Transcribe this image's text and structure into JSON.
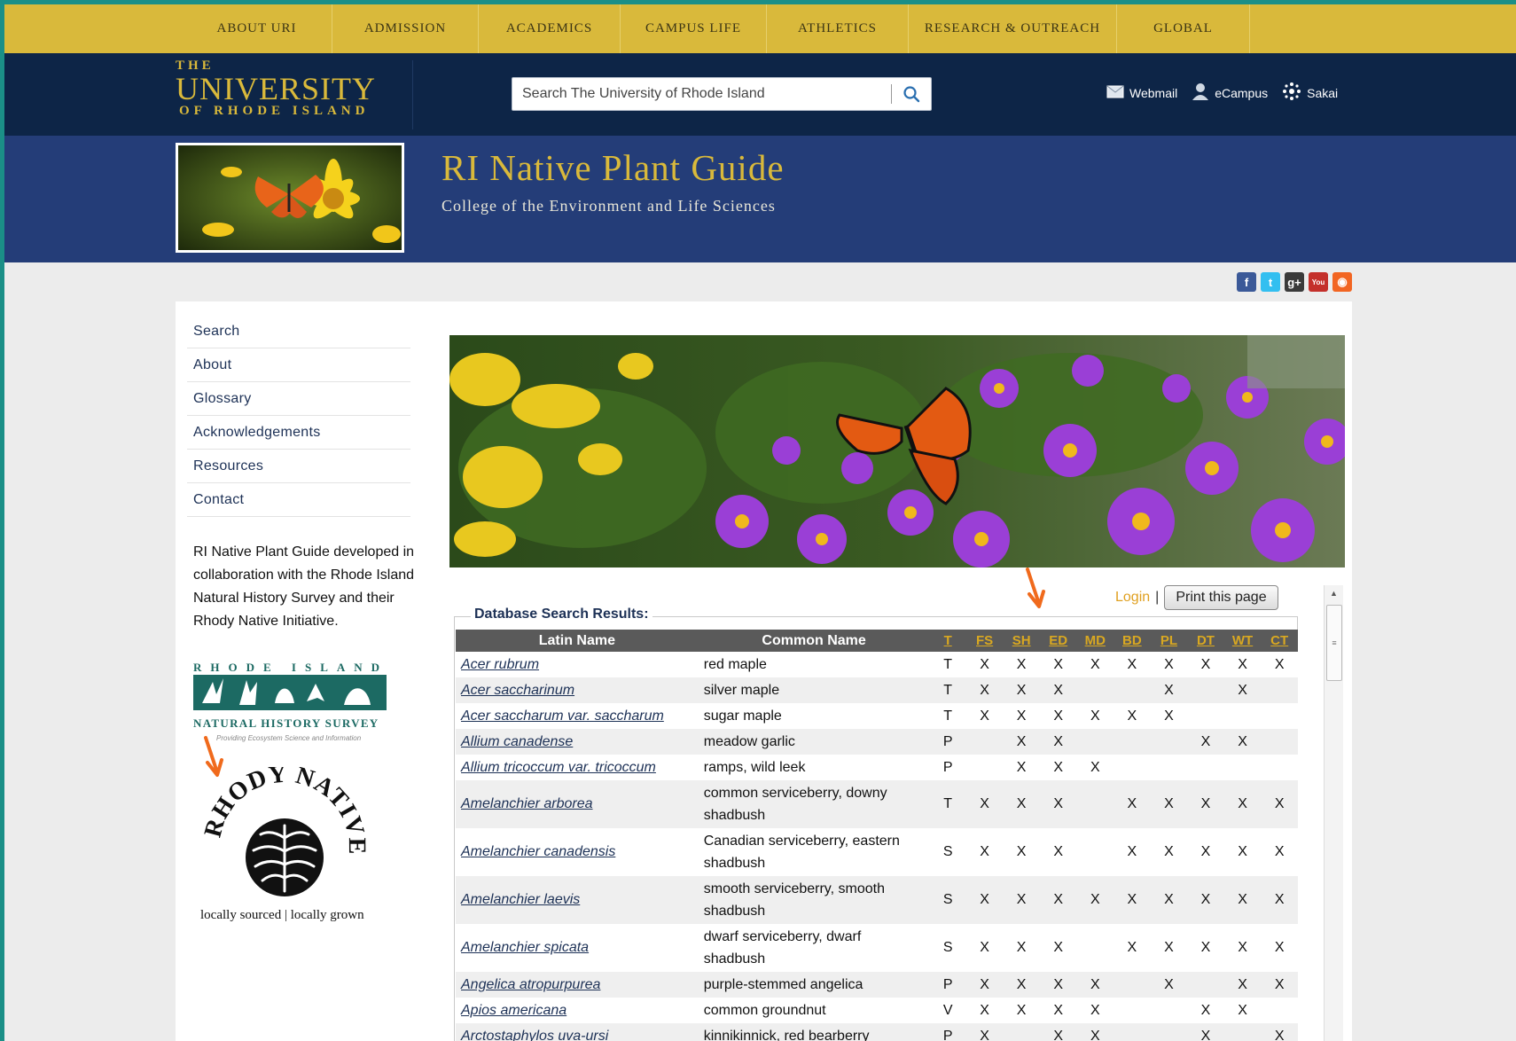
{
  "colors": {
    "frame": "#1b8f87",
    "gold": "#d9b93b",
    "navy": "#0d2547",
    "banner": "#243d78",
    "arrow": "#f06a1c"
  },
  "topnav": [
    "ABOUT URI",
    "ADMISSION",
    "ACADEMICS",
    "CAMPUS LIFE",
    "ATHLETICS",
    "RESEARCH & OUTREACH",
    "GLOBAL"
  ],
  "logo": {
    "the": "THE",
    "university": "UNIVERSITY",
    "ri": "OF RHODE ISLAND"
  },
  "search": {
    "placeholder": "Search The University of Rhode Island",
    "icon": "search-icon"
  },
  "quicklinks": [
    {
      "label": "Webmail",
      "icon": "mail-icon"
    },
    {
      "label": "eCampus",
      "icon": "person-icon"
    },
    {
      "label": "Sakai",
      "icon": "sakai-dots-icon"
    }
  ],
  "site": {
    "title": "RI Native Plant Guide",
    "subtitle": "College of the Environment and Life Sciences"
  },
  "social": [
    {
      "icon": "facebook-icon",
      "glyph": "f",
      "color": "#3b5998"
    },
    {
      "icon": "twitter-icon",
      "glyph": "t",
      "color": "#33bff0"
    },
    {
      "icon": "googleplus-icon",
      "glyph": "g+",
      "color": "#3a3a3a"
    },
    {
      "icon": "youtube-icon",
      "glyph": "You",
      "color": "#c4302b"
    },
    {
      "icon": "rss-icon",
      "glyph": "◉",
      "color": "#f26522"
    }
  ],
  "sidemenu": [
    "Search",
    "About",
    "Glossary",
    "Acknowledgements",
    "Resources",
    "Contact"
  ],
  "sidetext": "RI Native Plant Guide developed in collaboration with the Rhode Island Natural History Survey and their Rhody Native Initiative.",
  "rinhs": {
    "top": "RHODE ISLAND",
    "bottom": "NATURAL HISTORY SURVEY",
    "tagline": "Providing Ecosystem Science and Information"
  },
  "rhody": {
    "name": "RHODY NATIVE",
    "tagline": "locally sourced | locally grown"
  },
  "results": {
    "login": "Login",
    "pipe": "|",
    "print": "Print this page",
    "legend": "Database Search Results:",
    "headers": {
      "latin": "Latin Name",
      "common": "Common Name"
    },
    "codes": [
      "T",
      "FS",
      "SH",
      "ED",
      "MD",
      "BD",
      "PL",
      "DT",
      "WT",
      "CT"
    ],
    "rows": [
      {
        "latin": "Acer rubrum",
        "common": "red maple",
        "cells": [
          "T",
          "X",
          "X",
          "X",
          "X",
          "X",
          "X",
          "X",
          "X",
          "X"
        ]
      },
      {
        "latin": "Acer saccharinum",
        "common": "silver maple",
        "cells": [
          "T",
          "X",
          "X",
          "X",
          "",
          "",
          "X",
          "",
          "X",
          ""
        ]
      },
      {
        "latin": "Acer saccharum var. saccharum",
        "common": "sugar maple",
        "cells": [
          "T",
          "X",
          "X",
          "X",
          "X",
          "X",
          "X",
          "",
          "",
          ""
        ]
      },
      {
        "latin": "Allium canadense",
        "common": "meadow garlic",
        "cells": [
          "P",
          "",
          "X",
          "X",
          "",
          "",
          "",
          "X",
          "X",
          ""
        ]
      },
      {
        "latin": "Allium tricoccum var. tricoccum",
        "common": "ramps, wild leek",
        "cells": [
          "P",
          "",
          "X",
          "X",
          "X",
          "",
          "",
          "",
          "",
          ""
        ]
      },
      {
        "latin": "Amelanchier arborea",
        "common": "common serviceberry, downy shadbush",
        "cells": [
          "T",
          "X",
          "X",
          "X",
          "",
          "X",
          "X",
          "X",
          "X",
          "X"
        ]
      },
      {
        "latin": "Amelanchier canadensis",
        "common": "Canadian serviceberry, eastern shadbush",
        "cells": [
          "S",
          "X",
          "X",
          "X",
          "",
          "X",
          "X",
          "X",
          "X",
          "X"
        ]
      },
      {
        "latin": "Amelanchier laevis",
        "common": "smooth serviceberry, smooth shadbush",
        "cells": [
          "S",
          "X",
          "X",
          "X",
          "X",
          "X",
          "X",
          "X",
          "X",
          "X"
        ]
      },
      {
        "latin": "Amelanchier spicata",
        "common": "dwarf serviceberry, dwarf shadbush",
        "cells": [
          "S",
          "X",
          "X",
          "X",
          "",
          "X",
          "X",
          "X",
          "X",
          "X"
        ]
      },
      {
        "latin": "Angelica atropurpurea",
        "common": "purple-stemmed angelica",
        "cells": [
          "P",
          "X",
          "X",
          "X",
          "X",
          "",
          "X",
          "",
          "X",
          "X"
        ]
      },
      {
        "latin": "Apios americana",
        "common": "common groundnut",
        "cells": [
          "V",
          "X",
          "X",
          "X",
          "X",
          "",
          "",
          "X",
          "X",
          ""
        ]
      },
      {
        "latin": "Arctostaphylos uva-ursi",
        "common": "kinnikinnick, red bearberry",
        "cells": [
          "P",
          "X",
          "",
          "X",
          "X",
          "",
          "",
          "X",
          "",
          "X"
        ]
      }
    ]
  }
}
